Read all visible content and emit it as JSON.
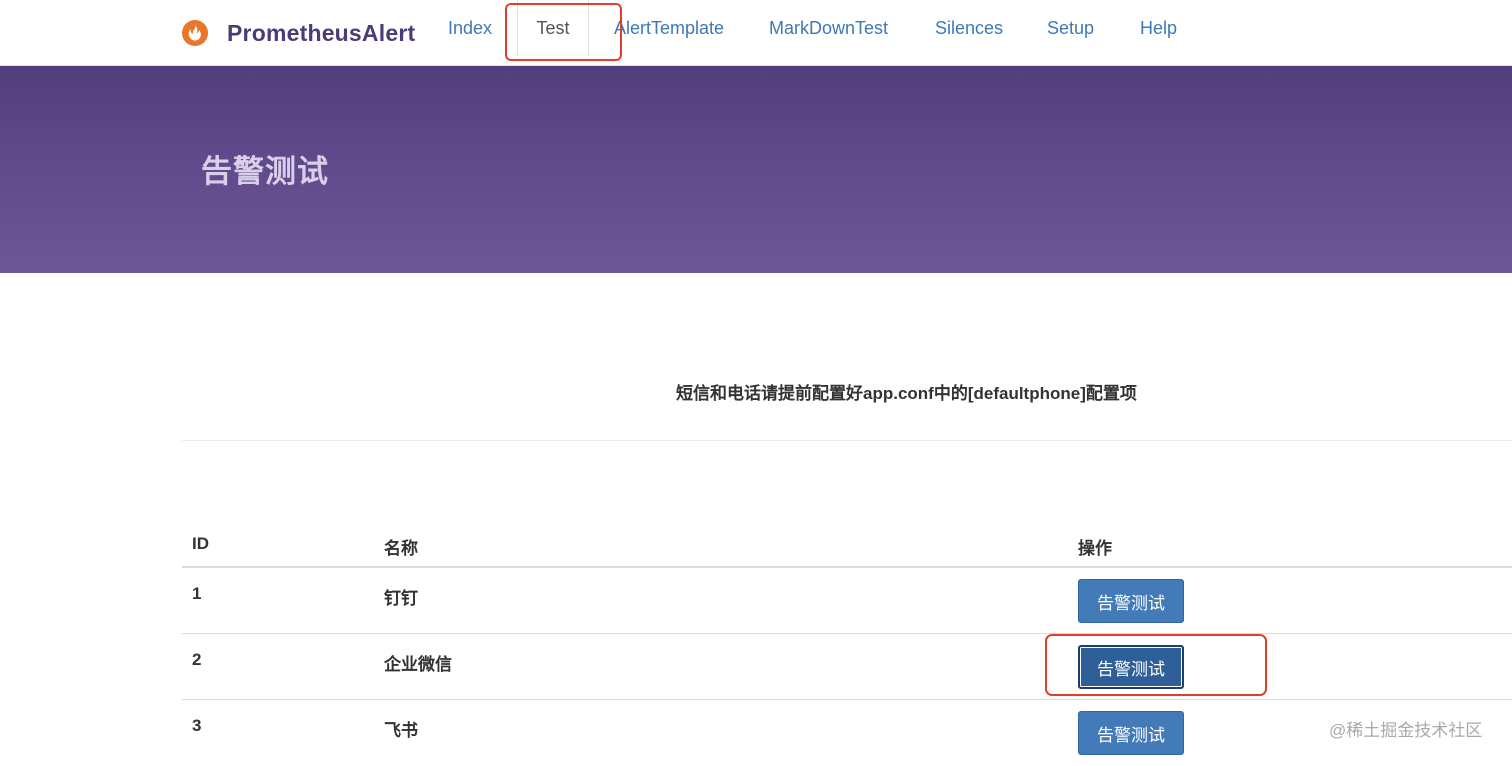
{
  "nav": {
    "brand": "PrometheusAlert",
    "items": [
      {
        "label": "Index"
      },
      {
        "label": "Test"
      },
      {
        "label": "AlertTemplate"
      },
      {
        "label": "MarkDownTest"
      },
      {
        "label": "Silences"
      },
      {
        "label": "Setup"
      },
      {
        "label": "Help"
      }
    ],
    "active": "Test"
  },
  "banner": {
    "title": "告警测试"
  },
  "notice": "短信和电话请提前配置好app.conf中的[defaultphone]配置项",
  "table": {
    "headers": [
      "ID",
      "名称",
      "操作"
    ],
    "rows": [
      {
        "id": "1",
        "name": "钉钉",
        "action": "告警测试"
      },
      {
        "id": "2",
        "name": "企业微信",
        "action": "告警测试"
      },
      {
        "id": "3",
        "name": "飞书",
        "action": "告警测试"
      }
    ]
  },
  "watermark": "@稀土掘金技术社区",
  "colors": {
    "brand": "#4d3b78",
    "link": "#3d79b7",
    "banner": "#614b8c",
    "button": "#437bb8",
    "highlight": "#e0402b"
  }
}
